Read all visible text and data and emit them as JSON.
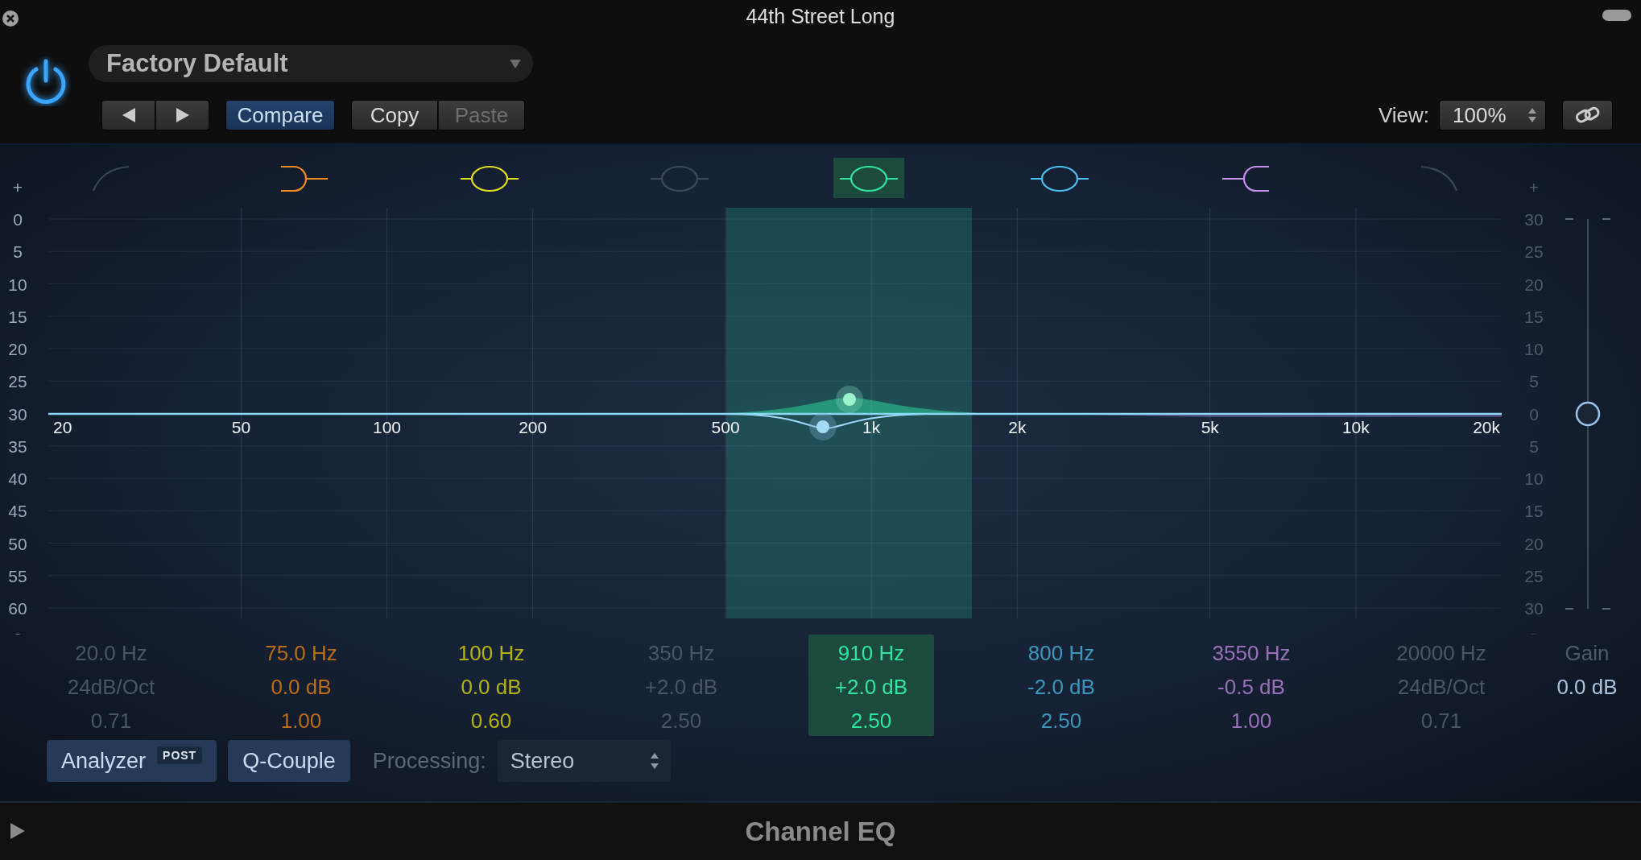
{
  "window": {
    "title": "44th Street Long"
  },
  "header": {
    "power_on": true,
    "preset": "Factory Default",
    "compare": {
      "label": "Compare",
      "on": true
    },
    "clipboard": [
      {
        "label": "Copy",
        "disabled": false
      },
      {
        "label": "Paste",
        "disabled": true
      }
    ],
    "view": {
      "label": "View:",
      "value": "100%"
    }
  },
  "graph": {
    "left_scale": [
      "+",
      "0",
      "5",
      "10",
      "15",
      "20",
      "25",
      "30",
      "35",
      "40",
      "45",
      "50",
      "55",
      "60",
      "-"
    ],
    "right_scale": [
      "+",
      "30",
      "25",
      "20",
      "15",
      "10",
      "5",
      "0",
      "5",
      "10",
      "15",
      "20",
      "25",
      "30",
      "-"
    ],
    "freq_labels": [
      "20",
      "50",
      "100",
      "200",
      "500",
      "1k",
      "2k",
      "5k",
      "10k",
      "20k"
    ]
  },
  "bands": [
    {
      "kind": "lowcut",
      "color": "#3a4656",
      "on": false,
      "selected": false,
      "frequency": "20.0 Hz",
      "slope": "24dB/Oct",
      "q": "0.71"
    },
    {
      "kind": "lowshelf",
      "color": "#f08a1c",
      "on": true,
      "selected": false,
      "frequency": "75.0 Hz",
      "gain": "0.0 dB",
      "q": "1.00"
    },
    {
      "kind": "bell",
      "color": "#e4e01e",
      "on": true,
      "selected": false,
      "frequency": "100 Hz",
      "gain": "0.0 dB",
      "q": "0.60"
    },
    {
      "kind": "bell",
      "color": "#3e4a58",
      "on": false,
      "selected": false,
      "frequency": "350 Hz",
      "gain": "+2.0 dB",
      "q": "2.50"
    },
    {
      "kind": "bell",
      "color": "#2ee6a0",
      "on": true,
      "selected": true,
      "frequency": "910 Hz",
      "gain": "+2.0 dB",
      "q": "2.50"
    },
    {
      "kind": "bell",
      "color": "#4cc0f0",
      "on": true,
      "selected": false,
      "frequency": "800 Hz",
      "gain": "-2.0 dB",
      "q": "2.50"
    },
    {
      "kind": "highshelf",
      "color": "#c490ec",
      "on": true,
      "selected": false,
      "frequency": "3550 Hz",
      "gain": "-0.5 dB",
      "q": "1.00"
    },
    {
      "kind": "highcut",
      "color": "#3a4656",
      "on": false,
      "selected": false,
      "frequency": "20000 Hz",
      "slope": "24dB/Oct",
      "q": "0.71"
    }
  ],
  "gain": {
    "label": "Gain",
    "value": "0.0 dB",
    "level": 0.5
  },
  "controls": {
    "analyzer": {
      "label": "Analyzer",
      "badge": "POST"
    },
    "q_couple": "Q-Couple",
    "processing": {
      "label": "Processing:",
      "value": "Stereo"
    }
  },
  "footer": {
    "title": "Channel EQ"
  }
}
